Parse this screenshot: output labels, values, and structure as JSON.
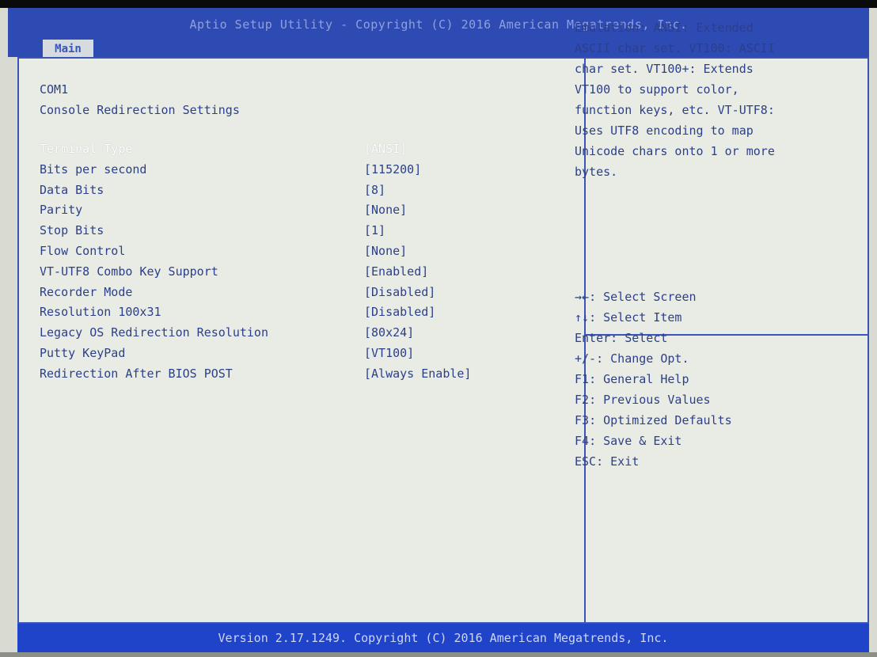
{
  "header": {
    "title": "Aptio Setup Utility - Copyright (C) 2016 American Megatrends, Inc.",
    "tab_main": "Main"
  },
  "section": {
    "title": "COM1",
    "subtitle": "Console Redirection Settings"
  },
  "settings": [
    {
      "label": "Terminal Type",
      "value": "[ANSI]",
      "selected": true
    },
    {
      "label": "Bits per second",
      "value": "[115200]"
    },
    {
      "label": "Data Bits",
      "value": "[8]"
    },
    {
      "label": "Parity",
      "value": "[None]"
    },
    {
      "label": "Stop Bits",
      "value": "[1]"
    },
    {
      "label": "Flow Control",
      "value": "[None]"
    },
    {
      "label": "VT-UTF8 Combo Key Support",
      "value": "[Enabled]"
    },
    {
      "label": "Recorder Mode",
      "value": "[Disabled]"
    },
    {
      "label": "Resolution 100x31",
      "value": "[Disabled]"
    },
    {
      "label": "Legacy OS Redirection Resolution",
      "value": "[80x24]"
    },
    {
      "label": "Putty KeyPad",
      "value": "[VT100]"
    },
    {
      "label": "Redirection After BIOS POST",
      "value": "[Always Enable]"
    }
  ],
  "help": {
    "lines": [
      "Emulation: ANSI: Extended",
      "ASCII char set. VT100: ASCII",
      "char set. VT100+: Extends",
      "VT100 to support color,",
      "function keys, etc. VT-UTF8:",
      "Uses UTF8 encoding to map",
      "Unicode chars onto 1 or more",
      "bytes."
    ]
  },
  "keys": [
    {
      "key": "→←",
      "desc": ": Select Screen"
    },
    {
      "key": "↑↓",
      "desc": ": Select Item"
    },
    {
      "key": "Enter",
      "desc": ": Select"
    },
    {
      "key": "+/-",
      "desc": ": Change Opt."
    },
    {
      "key": "F1",
      "desc": ": General Help"
    },
    {
      "key": "F2",
      "desc": ": Previous Values"
    },
    {
      "key": "F3",
      "desc": ": Optimized Defaults"
    },
    {
      "key": "F4",
      "desc": ": Save & Exit"
    },
    {
      "key": "ESC",
      "desc": ": Exit"
    }
  ],
  "footer": {
    "text": "Version 2.17.1249. Copyright (C) 2016 American Megatrends, Inc."
  }
}
